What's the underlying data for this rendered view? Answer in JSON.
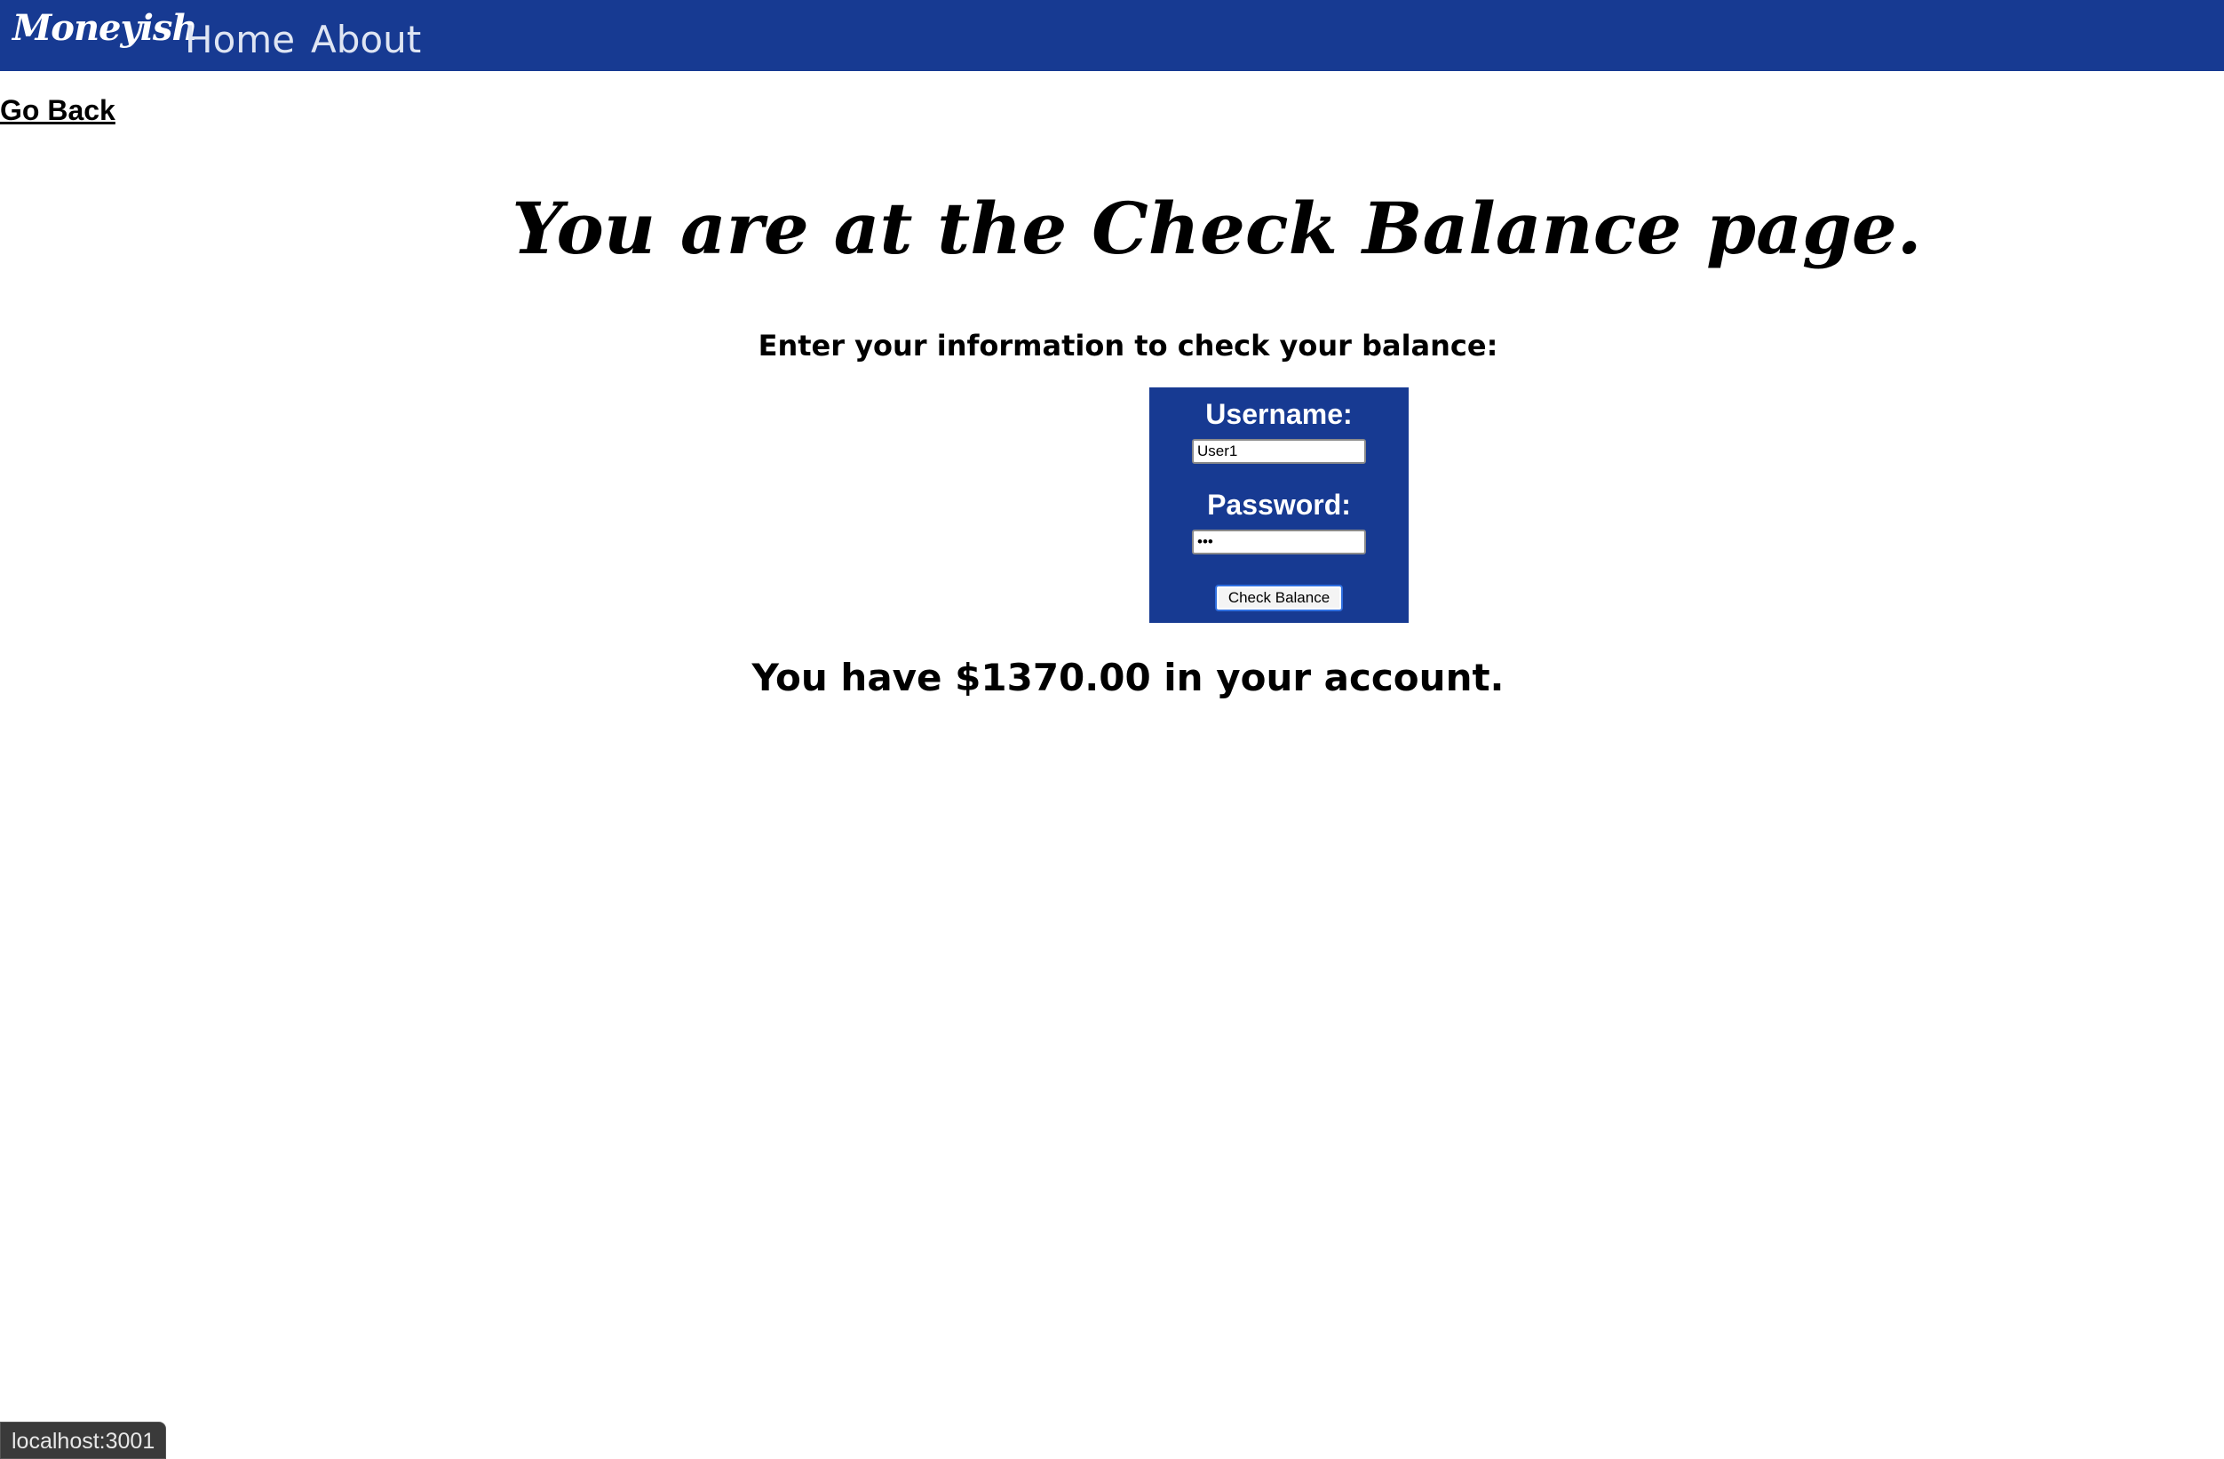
{
  "navbar": {
    "brand": "Moneyish",
    "links": [
      {
        "label": "Home"
      },
      {
        "label": "About"
      }
    ]
  },
  "go_back_label": "Go Back",
  "page_title": "You are at the Check Balance page.",
  "instructions": "Enter your information to check your balance:",
  "form": {
    "username_label": "Username:",
    "username_value": "User1",
    "password_label": "Password:",
    "password_value": "•••",
    "submit_label": "Check Balance"
  },
  "balance_message": "You have $1370.00 in your account.",
  "status_bar": "localhost:3001",
  "colors": {
    "navbar": "#173a92",
    "form_background": "#173a92",
    "text": "#000000"
  }
}
